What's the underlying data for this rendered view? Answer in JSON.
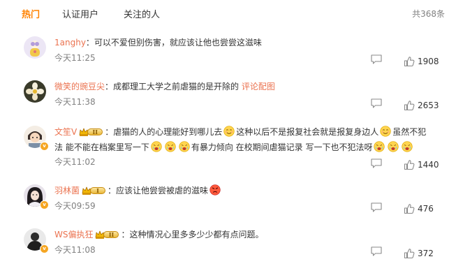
{
  "tabs": [
    {
      "label": "热门",
      "active": true
    },
    {
      "label": "认证用户",
      "active": false
    },
    {
      "label": "关注的人",
      "active": false
    }
  ],
  "total": "共368条",
  "colors": {
    "accent": "#ff8200",
    "username": "#eb7350",
    "meta": "#808080"
  },
  "comments": [
    {
      "user": "1anghy",
      "text": "：可以不爱但别伤害，就应该让他也尝尝这滋味",
      "time": "今天11:25",
      "likes": "1908"
    },
    {
      "user": "微笑的豌豆尖",
      "text": "：成都理工大学之前虐猫的是开除的",
      "link": "评论配图",
      "time": "今天11:38",
      "likes": "2653"
    },
    {
      "user": "文笙V",
      "medal_level": "II",
      "segments": [
        "：虐猫的人的心理能好到哪儿去",
        "这种以后不是报复社会就是报复身边人",
        "虽然不犯法 能不能在档案里写一下",
        "有暴力倾向 在校期间虐猫记录 写一下也不犯法呀"
      ],
      "time": "今天11:02",
      "likes": "1440"
    },
    {
      "user": "羽林菌",
      "medal_level": "I",
      "text": "：应该让他尝尝被虐的滋味",
      "time": "今天09:59",
      "likes": "476"
    },
    {
      "user": "WS偏执狂",
      "medal_level": "II",
      "text": "：这种情况心里多多少少都有点问题。",
      "time": "今天11:08",
      "likes": "372"
    }
  ]
}
